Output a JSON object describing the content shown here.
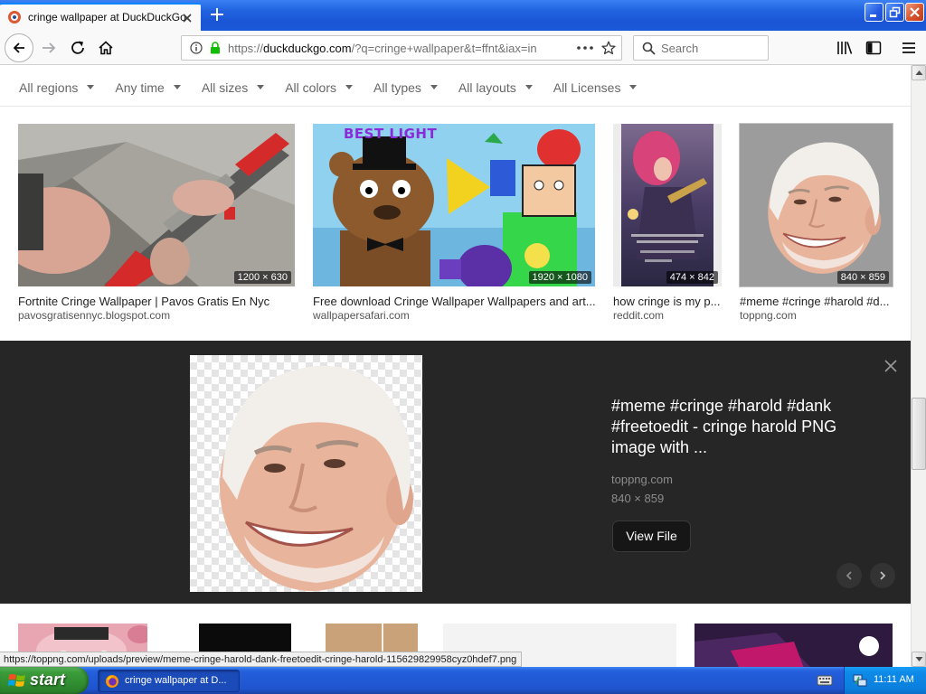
{
  "browser": {
    "tab_title": "cringe wallpaper at DuckDuckGo",
    "url_scheme": "https://",
    "url_host": "duckduckgo.com",
    "url_path": "/?q=cringe+wallpaper&t=ffnt&iax=in",
    "search_placeholder": "Search"
  },
  "filters": [
    "All regions",
    "Any time",
    "All sizes",
    "All colors",
    "All types",
    "All layouts",
    "All Licenses"
  ],
  "results": [
    {
      "title": "Fortnite Cringe Wallpaper | Pavos Gratis En Nyc",
      "source": "pavosgratisennyc.blogspot.com",
      "size": "1200 × 630"
    },
    {
      "title": "Free download Cringe Wallpaper Wallpapers and art...",
      "source": "wallpapersafari.com",
      "size": "1920 × 1080",
      "image_text": "BEST LIGHT"
    },
    {
      "title": "how cringe is my p...",
      "source": "reddit.com",
      "size": "474 × 842"
    },
    {
      "title": "#meme #cringe #harold #d...",
      "source": "toppng.com",
      "size": "840 × 859"
    }
  ],
  "detail": {
    "title": "#meme #cringe #harold #dank #freetoedit - cringe harold PNG image with ...",
    "source": "toppng.com",
    "size": "840 × 859",
    "view_button": "View File"
  },
  "status_bar_url": "https://toppng.com/uploads/preview/meme-cringe-harold-dank-freetoedit-cringe-harold-115629829958cyz0hdef7.png",
  "taskbar": {
    "start_label": "start",
    "task_label": "cringe wallpaper at D...",
    "clock": "11:11 AM"
  },
  "icons": [
    "duckduckgo-favicon-icon",
    "close-tab-icon",
    "new-tab-icon",
    "minimize-icon",
    "restore-icon",
    "close-window-icon",
    "back-arrow-icon",
    "forward-arrow-icon",
    "reload-icon",
    "home-icon",
    "info-icon",
    "lock-icon",
    "page-actions-icon",
    "bookmark-star-icon",
    "search-icon",
    "library-icon",
    "sidebar-icon",
    "hamburger-menu-icon",
    "close-icon",
    "chevron-left-icon",
    "chevron-right-icon",
    "windows-flag-icon",
    "firefox-icon",
    "keyboard-icon",
    "network-icon"
  ],
  "colors": {
    "titlebar_blue": "#1a56d6",
    "tab_accent": "#0a84ff",
    "detail_panel_bg": "#262626",
    "taskbar_blue": "#245edb",
    "start_green": "#2f8a2f",
    "lock_green": "#12bc00"
  }
}
